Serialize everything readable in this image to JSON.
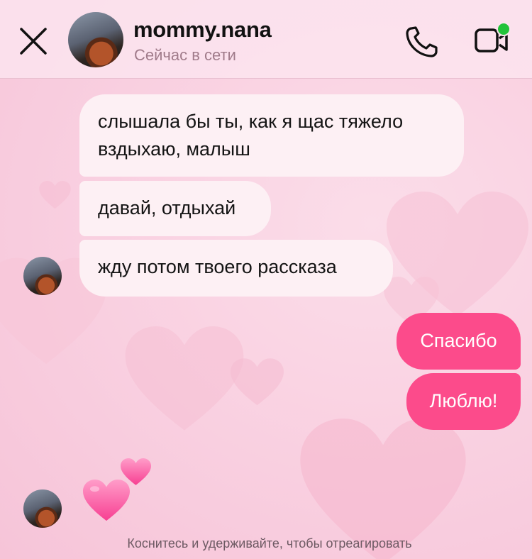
{
  "header": {
    "username": "mommy.nana",
    "status": "Сейчас в сети"
  },
  "messages": {
    "incoming": [
      "слышала бы ты, как я щас тяжело вздыхаю, малыш",
      "давай, отдыхай",
      "жду потом твоего рассказа"
    ],
    "outgoing": [
      "Спасибо",
      "Люблю!"
    ],
    "emoji_message": "two-hearts-emoji"
  },
  "footer": {
    "hint": "Коснитесь и удерживайте, чтобы отреагировать"
  },
  "colors": {
    "outgoing_bubble": "#fc4b8b",
    "incoming_bubble": "#fdf0f4",
    "online_indicator": "#22c33a"
  }
}
